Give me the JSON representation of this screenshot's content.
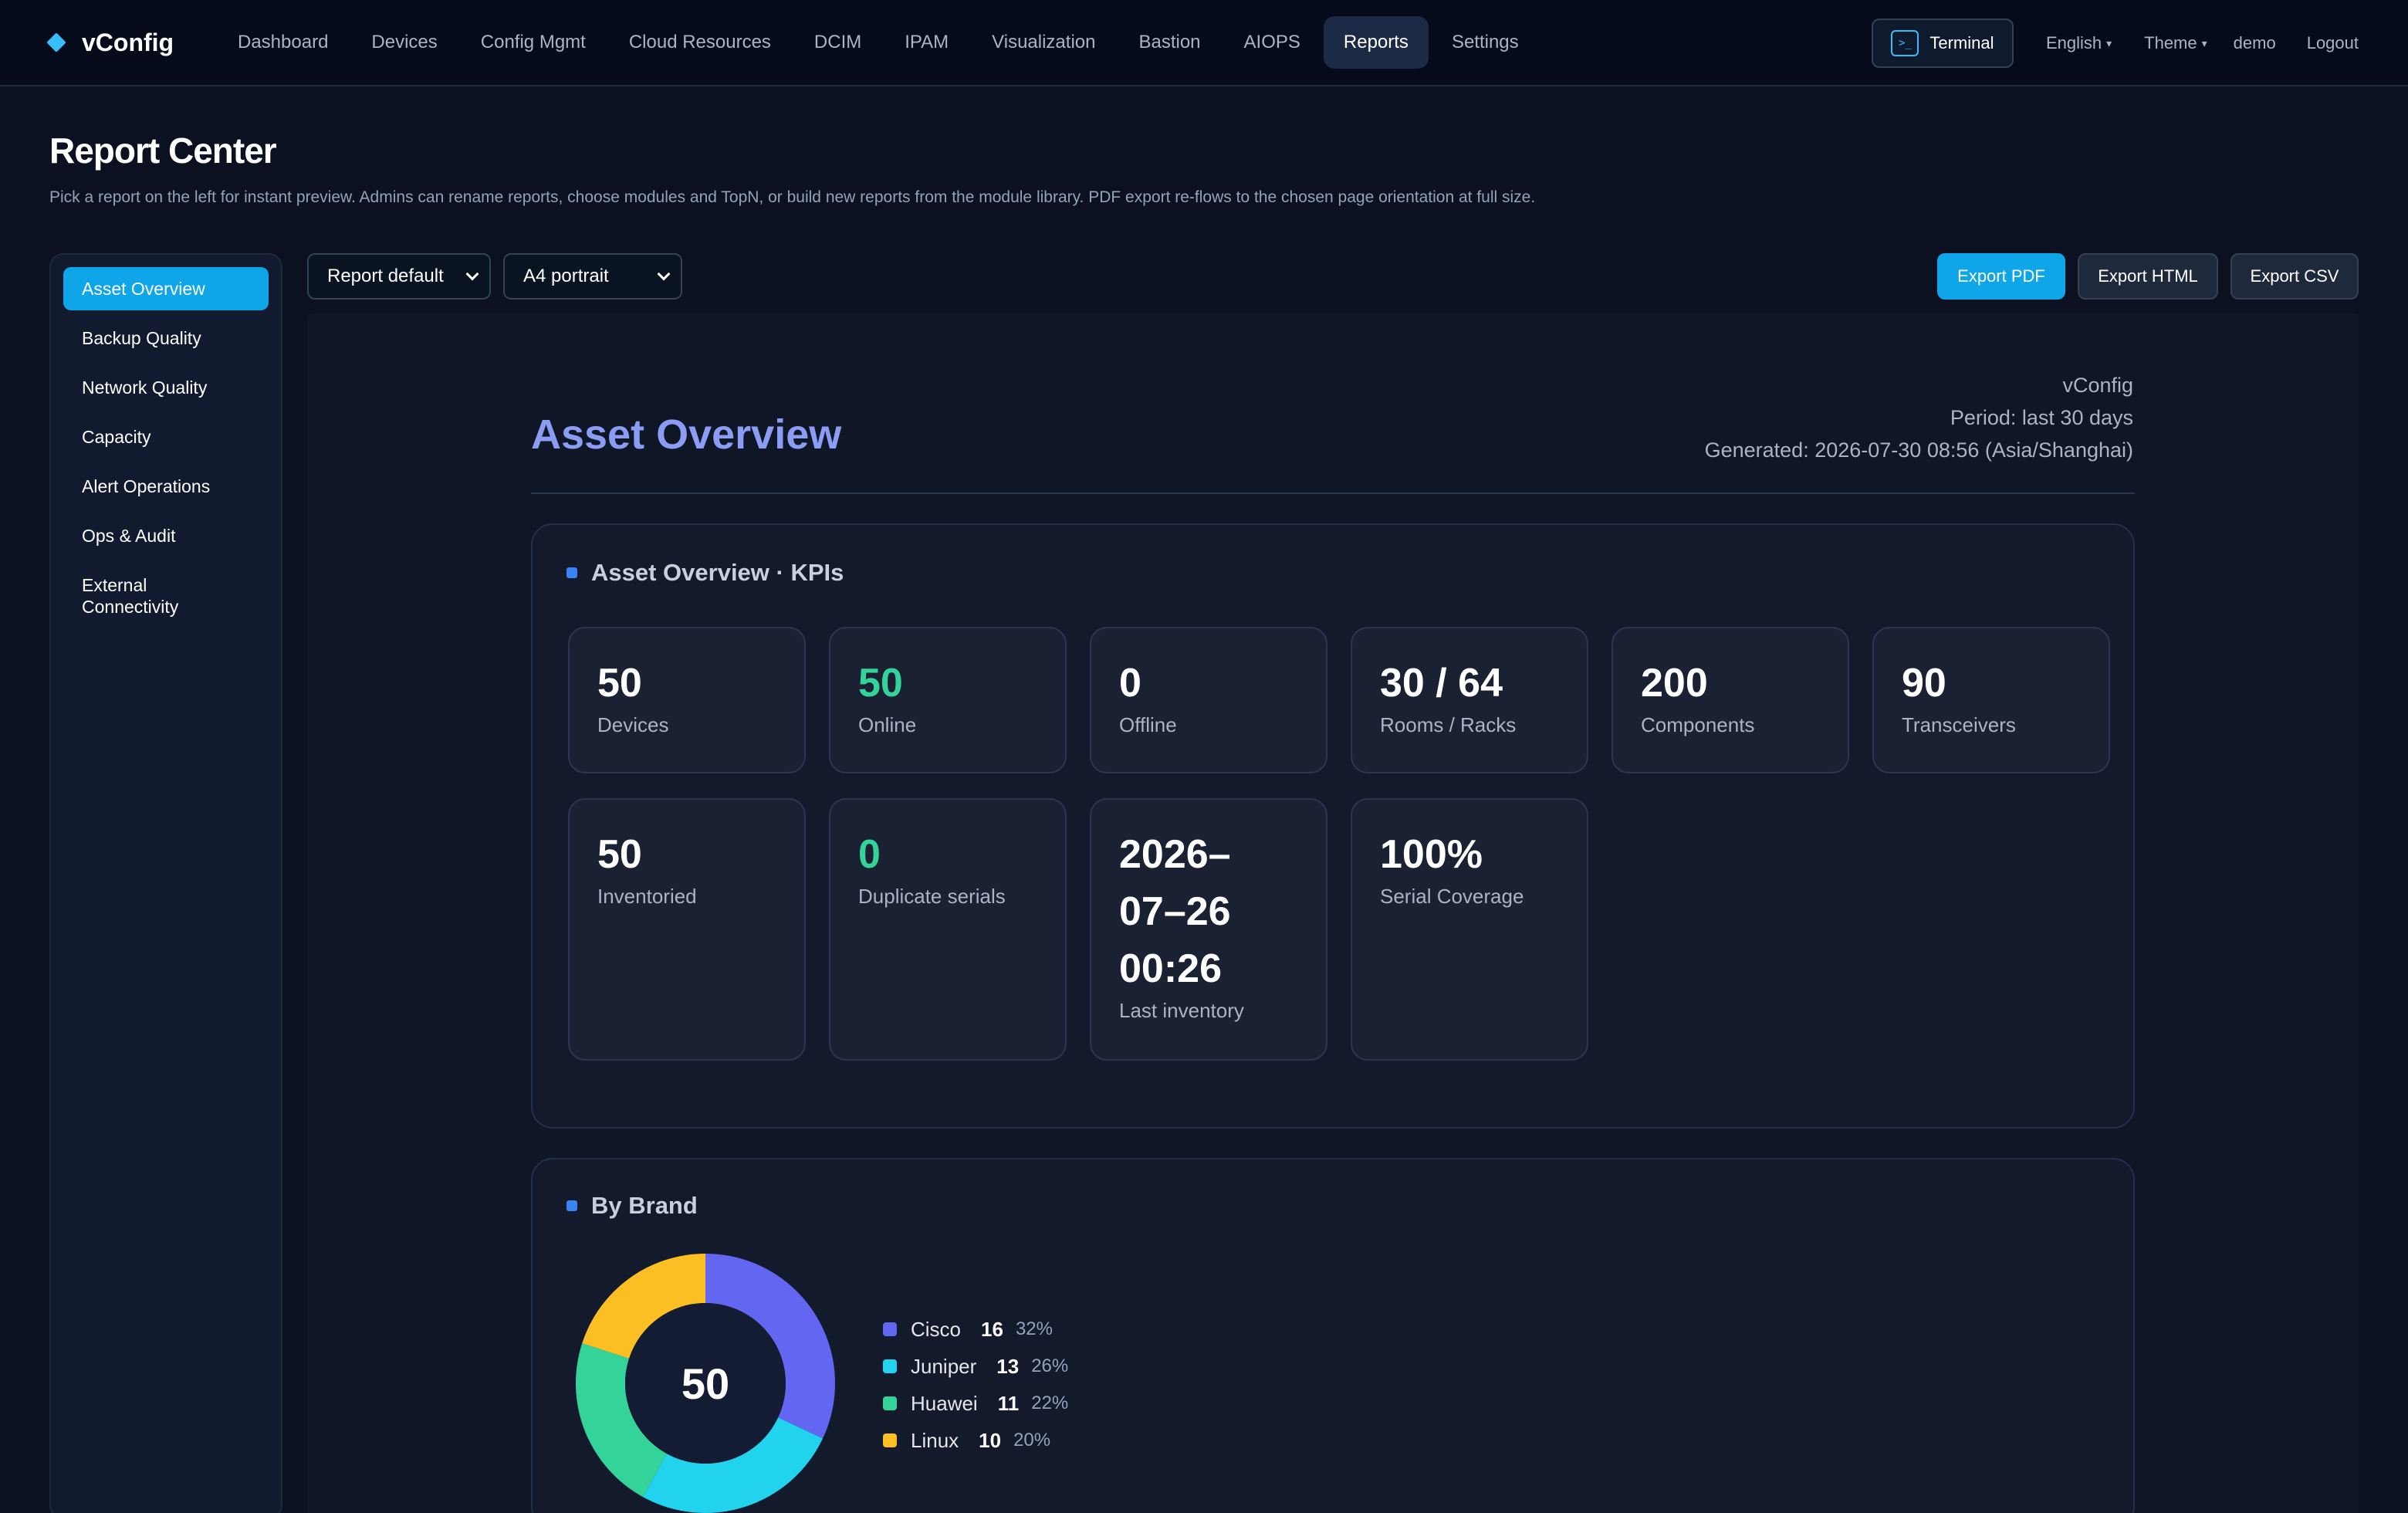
{
  "app": {
    "name": "vConfig"
  },
  "nav": {
    "items": [
      {
        "label": "Dashboard",
        "name": "nav-dashboard",
        "active": false
      },
      {
        "label": "Devices",
        "name": "nav-devices",
        "active": false
      },
      {
        "label": "Config Mgmt",
        "name": "nav-config-mgmt",
        "active": false
      },
      {
        "label": "Cloud Resources",
        "name": "nav-cloud-resources",
        "active": false
      },
      {
        "label": "DCIM",
        "name": "nav-dcim",
        "active": false
      },
      {
        "label": "IPAM",
        "name": "nav-ipam",
        "active": false
      },
      {
        "label": "Visualization",
        "name": "nav-visualization",
        "active": false
      },
      {
        "label": "Bastion",
        "name": "nav-bastion",
        "active": false
      },
      {
        "label": "AIOPS",
        "name": "nav-aiops",
        "active": false
      },
      {
        "label": "Reports",
        "name": "nav-reports",
        "active": true
      },
      {
        "label": "Settings",
        "name": "nav-settings",
        "active": false
      }
    ],
    "terminal_label": "Terminal",
    "language": "English",
    "theme": "Theme",
    "user": "demo",
    "logout": "Logout"
  },
  "page": {
    "title": "Report Center",
    "subtitle": "Pick a report on the left for instant preview. Admins can rename reports, choose modules and TopN, or build new reports from the module library. PDF export re-flows to the chosen page orientation at full size."
  },
  "sidebar": {
    "items": [
      {
        "label": "Asset Overview",
        "active": true
      },
      {
        "label": "Backup Quality",
        "active": false
      },
      {
        "label": "Network Quality",
        "active": false
      },
      {
        "label": "Capacity",
        "active": false
      },
      {
        "label": "Alert Operations",
        "active": false
      },
      {
        "label": "Ops & Audit",
        "active": false
      },
      {
        "label": "External Connectivity",
        "active": false
      }
    ]
  },
  "toolbar": {
    "template_select": "Report default",
    "page_select": "A4 portrait",
    "export_pdf": "Export PDF",
    "export_html": "Export HTML",
    "export_csv": "Export CSV"
  },
  "report": {
    "title": "Asset Overview",
    "meta": {
      "brand": "vConfig",
      "period": "Period: last 30 days",
      "generated": "Generated: 2026-07-30 08:56 (Asia/Shanghai)"
    },
    "kpi_section_title": "Asset Overview · KPIs",
    "kpis": [
      {
        "value": "50",
        "label": "Devices",
        "accent": false
      },
      {
        "value": "50",
        "label": "Online",
        "accent": true
      },
      {
        "value": "0",
        "label": "Offline",
        "accent": false
      },
      {
        "value": "30 / 64",
        "label": "Rooms / Racks",
        "accent": false
      },
      {
        "value": "200",
        "label": "Components",
        "accent": false
      },
      {
        "value": "90",
        "label": "Transceivers",
        "accent": false
      },
      {
        "value": "50",
        "label": "Inventoried",
        "accent": false
      },
      {
        "value": "0",
        "label": "Duplicate serials",
        "accent": true
      },
      {
        "value": "2026–07–26 00:26",
        "label": "Last inventory",
        "accent": false
      },
      {
        "value": "100%",
        "label": "Serial Coverage",
        "accent": false
      }
    ],
    "brand_section_title": "By Brand"
  },
  "chart_data": {
    "type": "pie",
    "title": "By Brand",
    "center_label": "50",
    "categories": [
      "Cisco",
      "Juniper",
      "Huawei",
      "Linux"
    ],
    "values": [
      16,
      13,
      11,
      10
    ],
    "percents": [
      "32%",
      "26%",
      "22%",
      "20%"
    ],
    "colors": [
      "#6366f1",
      "#22d3ee",
      "#34d399",
      "#fbbf24"
    ],
    "legend": "right"
  }
}
